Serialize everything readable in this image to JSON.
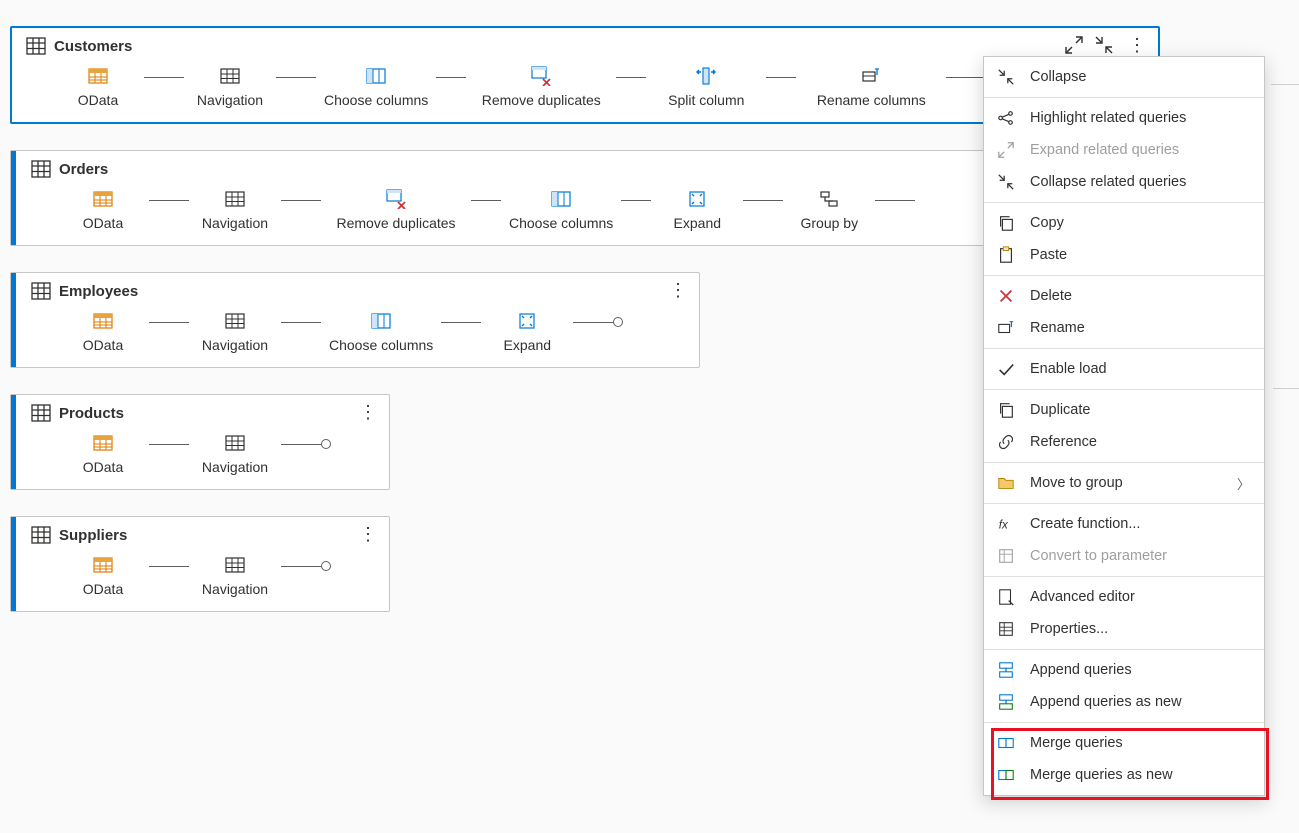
{
  "queries": {
    "customers": {
      "title": "Customers",
      "steps": [
        "OData",
        "Navigation",
        "Choose columns",
        "Remove duplicates",
        "Split column",
        "Rename columns"
      ]
    },
    "orders": {
      "title": "Orders",
      "steps": [
        "OData",
        "Navigation",
        "Remove duplicates",
        "Choose columns",
        "Expand",
        "Group by"
      ]
    },
    "employees": {
      "title": "Employees",
      "steps": [
        "OData",
        "Navigation",
        "Choose columns",
        "Expand"
      ]
    },
    "products": {
      "title": "Products",
      "steps": [
        "OData",
        "Navigation"
      ]
    },
    "suppliers": {
      "title": "Suppliers",
      "steps": [
        "OData",
        "Navigation"
      ]
    }
  },
  "menu": {
    "collapse": "Collapse",
    "highlight_related": "Highlight related queries",
    "expand_related": "Expand related queries",
    "collapse_related": "Collapse related queries",
    "copy": "Copy",
    "paste": "Paste",
    "delete": "Delete",
    "rename": "Rename",
    "enable_load": "Enable load",
    "duplicate": "Duplicate",
    "reference": "Reference",
    "move_to_group": "Move to group",
    "create_function": "Create function...",
    "convert_param": "Convert to parameter",
    "advanced_editor": "Advanced editor",
    "properties": "Properties...",
    "append": "Append queries",
    "append_new": "Append queries as new",
    "merge": "Merge queries",
    "merge_new": "Merge queries as new"
  }
}
